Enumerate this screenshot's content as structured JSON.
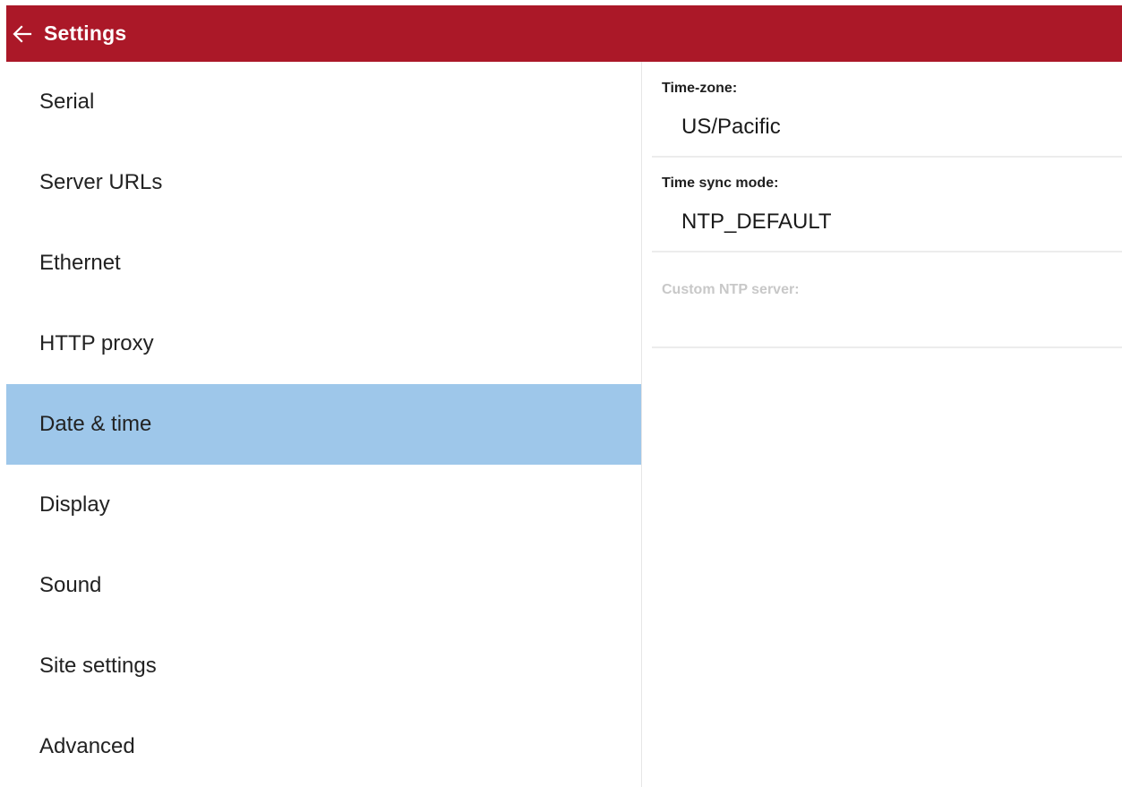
{
  "header": {
    "title": "Settings",
    "back_icon": "arrow-left-icon",
    "background_color": "#ab1828"
  },
  "sidebar": {
    "active_color": "#9ec7ea",
    "items": [
      {
        "label": "Serial"
      },
      {
        "label": "Server URLs"
      },
      {
        "label": "Ethernet"
      },
      {
        "label": "HTTP proxy"
      },
      {
        "label": "Date & time",
        "active": true
      },
      {
        "label": "Display"
      },
      {
        "label": "Sound"
      },
      {
        "label": "Site settings"
      },
      {
        "label": "Advanced"
      }
    ]
  },
  "content": {
    "time_zone": {
      "label": "Time-zone:",
      "value": "US/Pacific"
    },
    "time_sync_mode": {
      "label": "Time sync mode:",
      "value": "NTP_DEFAULT"
    },
    "custom_ntp_server": {
      "label": "Custom NTP server:",
      "value": "",
      "disabled": true
    }
  }
}
